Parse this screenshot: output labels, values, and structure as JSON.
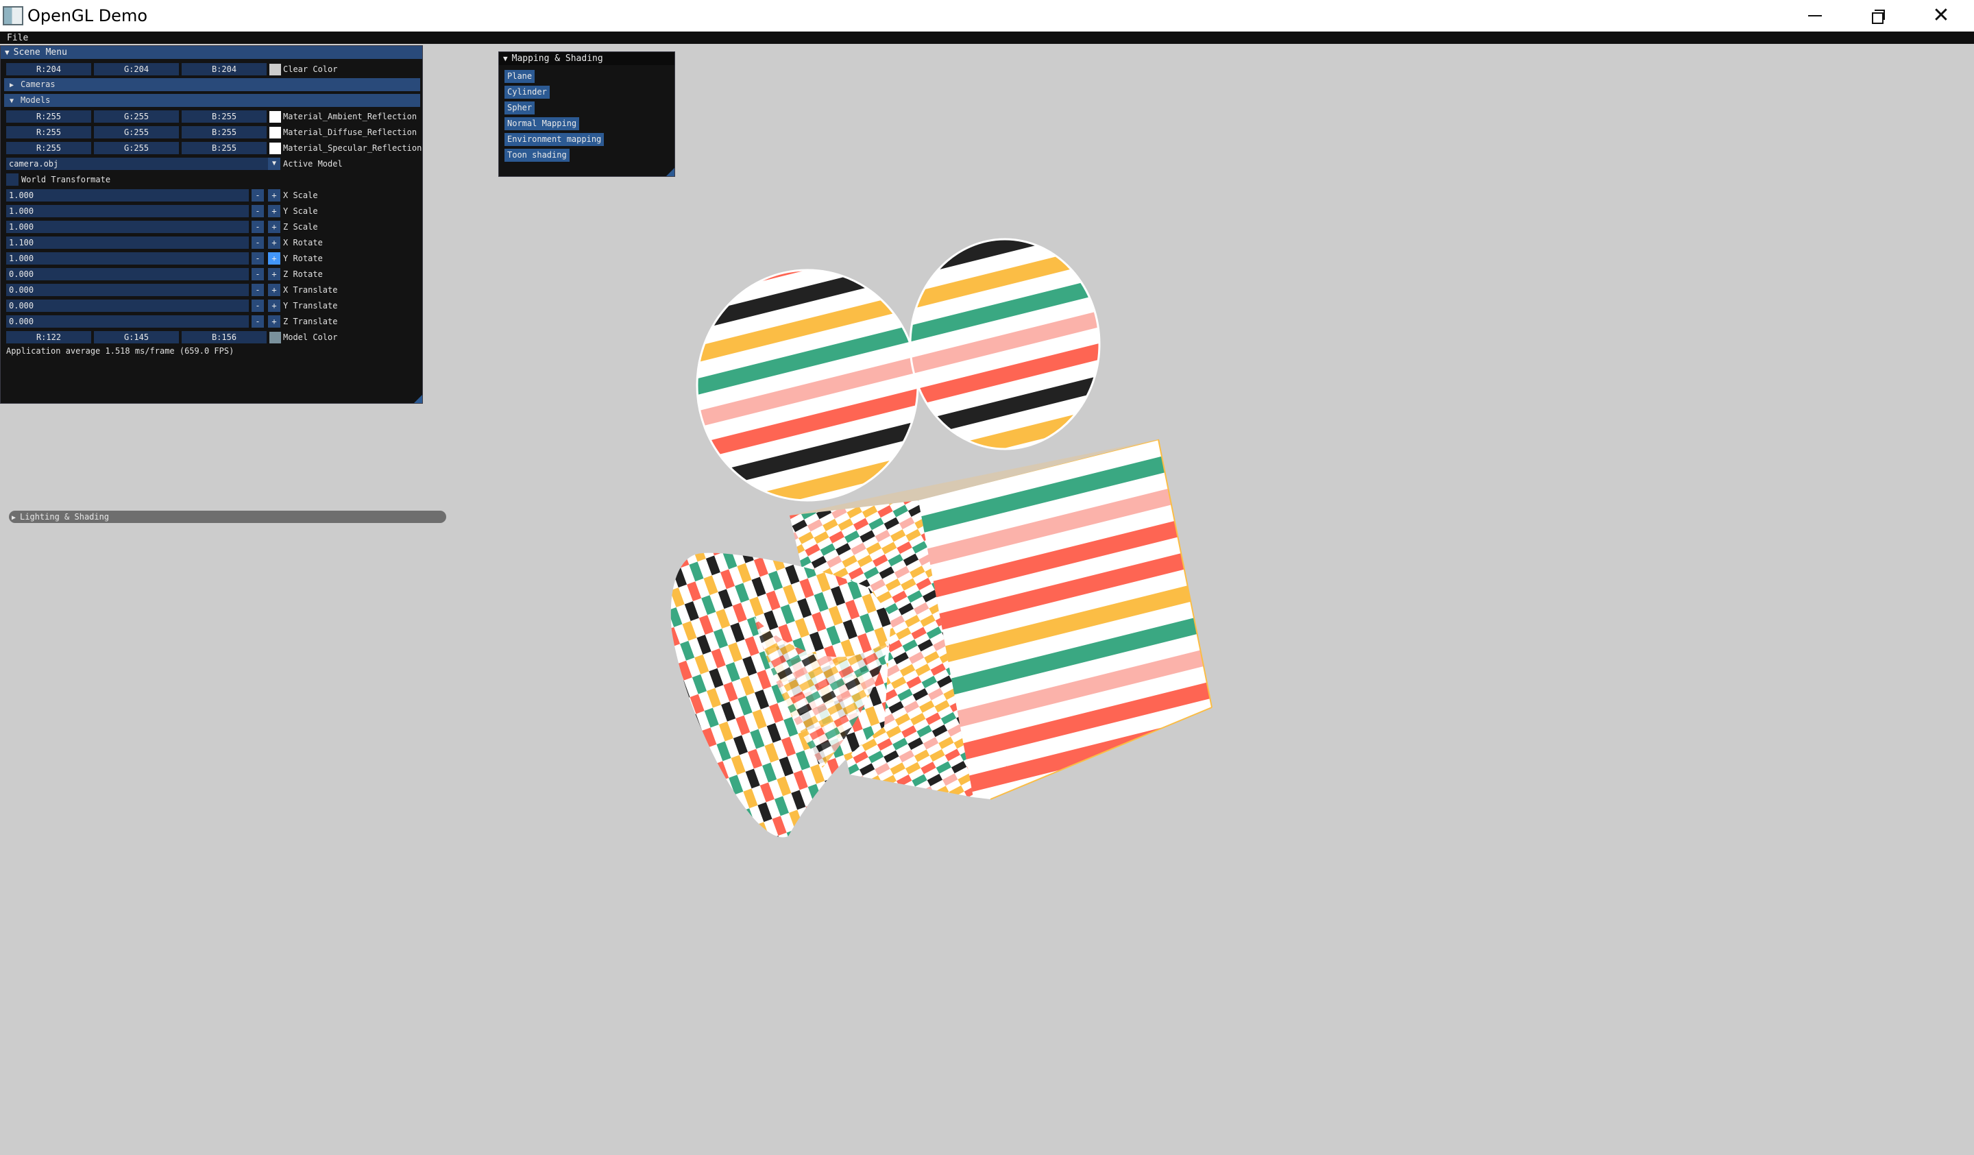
{
  "window": {
    "title": "OpenGL Demo",
    "min_icon": "minimize-icon",
    "max_icon": "restore-icon",
    "close_icon": "close-icon"
  },
  "menu": {
    "file": "File"
  },
  "scene_menu": {
    "title": "Scene Menu",
    "clear_color": {
      "r": "R:204",
      "g": "G:204",
      "b": "B:204",
      "label": "Clear Color",
      "swatch": "#cccccc"
    },
    "cameras_header": "Cameras",
    "models_header": "Models",
    "ambient": {
      "r": "R:255",
      "g": "G:255",
      "b": "B:255",
      "label": "Material_Ambient_Reflection",
      "swatch": "#ffffff"
    },
    "diffuse": {
      "r": "R:255",
      "g": "G:255",
      "b": "B:255",
      "label": "Material_Diffuse_Reflection",
      "swatch": "#ffffff"
    },
    "specular": {
      "r": "R:255",
      "g": "G:255",
      "b": "B:255",
      "label": "Material_Specular_Reflection",
      "swatch": "#ffffff"
    },
    "active_model": {
      "value": "camera.obj",
      "label": "Active Model"
    },
    "world_transform_label": "World Transformate",
    "transforms": [
      {
        "value": "1.000",
        "label": "X Scale"
      },
      {
        "value": "1.000",
        "label": "Y Scale"
      },
      {
        "value": "1.000",
        "label": "Z Scale"
      },
      {
        "value": "1.100",
        "label": "X Rotate"
      },
      {
        "value": "1.000",
        "label": "Y Rotate"
      },
      {
        "value": "0.000",
        "label": "Z Rotate"
      },
      {
        "value": "0.000",
        "label": "X Translate"
      },
      {
        "value": "0.000",
        "label": "Y Translate"
      },
      {
        "value": "0.000",
        "label": "Z Translate"
      }
    ],
    "step_minus": "-",
    "step_plus": "+",
    "model_color": {
      "r": "R:122",
      "g": "G:145",
      "b": "B:156",
      "label": "Model Color",
      "swatch": "#7a919c"
    },
    "fps": "Application average 1.518 ms/frame (659.0 FPS)"
  },
  "mapping": {
    "title": "Mapping & Shading",
    "buttons": [
      "Plane",
      "Cylinder",
      "Spher",
      "Normal Mapping",
      "Environment mapping",
      "Toon shading"
    ]
  },
  "lighting": {
    "title": "Lighting & Shading"
  },
  "viewport": {
    "model": "camera.obj",
    "stripe_colors": [
      "#222222",
      "#ffffff",
      "#fbbd45",
      "#ffffff",
      "#3aa882",
      "#ffffff",
      "#fbb2aa",
      "#ffffff",
      "#fe6553",
      "#ffffff"
    ]
  }
}
